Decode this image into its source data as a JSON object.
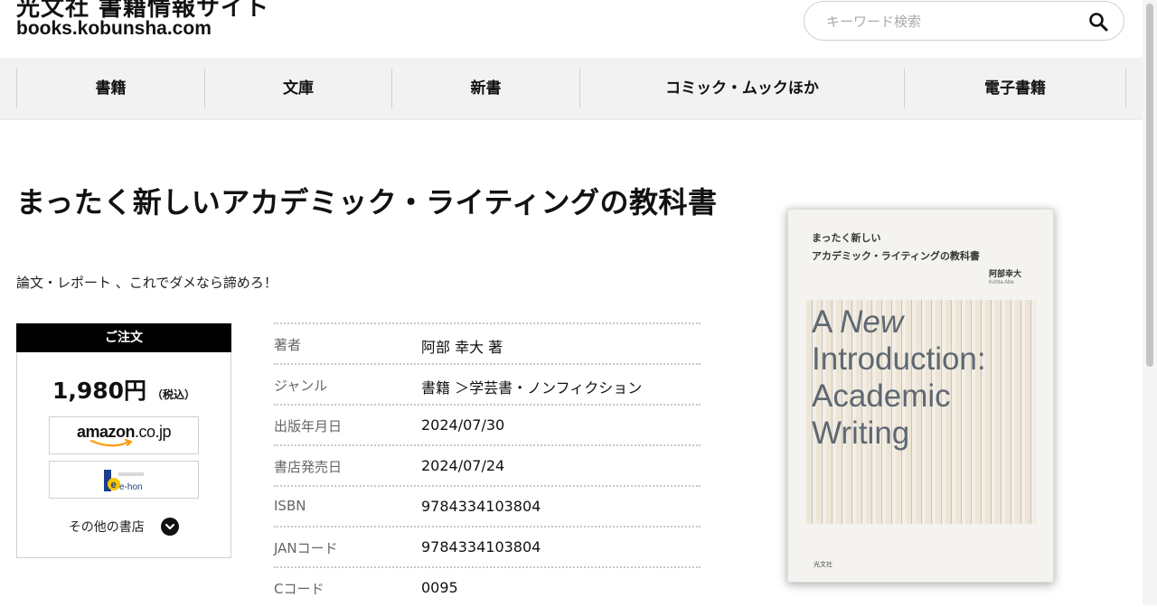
{
  "header": {
    "site_title": "光文社 書籍情報サイト",
    "site_url": "books.kobunsha.com",
    "search_placeholder": "キーワード検索"
  },
  "nav": {
    "items": [
      "書籍",
      "文庫",
      "新書",
      "コミック・ムックほか",
      "電子書籍"
    ]
  },
  "book": {
    "title": "まったく新しいアカデミック・ライティングの教科書",
    "subtitle": "論文・レポート 、これでダメなら諦めろ！"
  },
  "order": {
    "header": "ご注文",
    "price": "1,980円",
    "tax_note": "（税込）",
    "amazon_label_bold": "amazon",
    "amazon_label_rest": ".co.jp",
    "ehon_label": "e-hon",
    "other_stores": "その他の書店"
  },
  "info": [
    {
      "label": "著者",
      "value": "阿部 幸大 著"
    },
    {
      "label": "ジャンル",
      "value": "書籍 ＞学芸書・ノンフィクション"
    },
    {
      "label": "出版年月日",
      "value": "2024/07/30"
    },
    {
      "label": "書店発売日",
      "value": "2024/07/24"
    },
    {
      "label": "ISBN",
      "value": "9784334103804"
    },
    {
      "label": "JANコード",
      "value": "9784334103804"
    },
    {
      "label": "Cコード",
      "value": "0095"
    }
  ],
  "cover": {
    "jp_title_line1": "まったく新しい",
    "jp_title_line2": "アカデミック・ライティングの教科書",
    "author_jp": "阿部幸大",
    "author_en": "Kohta Abe",
    "en_title_word1": "A",
    "en_title_word2": "New",
    "en_title_line2": "Introduction:",
    "en_title_line3": "Academic",
    "en_title_line4": "Writing",
    "publisher": "光文社"
  },
  "colors": {
    "nav_bg": "#f2f2f2",
    "order_header_bg": "#000000",
    "cover_title": "#5f6872"
  },
  "icons": {
    "search": "magnifier-icon",
    "other_stores": "chevron-down-circle-icon"
  }
}
